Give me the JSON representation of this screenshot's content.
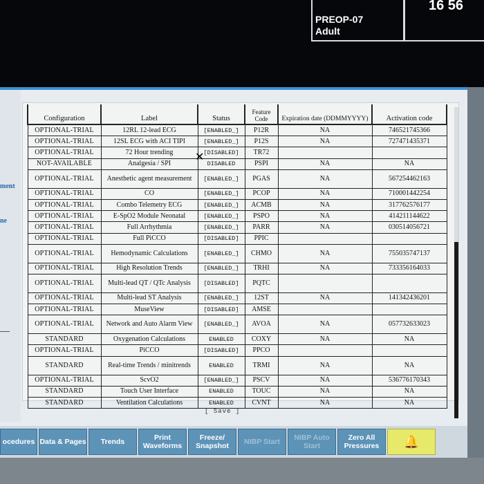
{
  "header": {
    "patient_id": "PREOP-07",
    "patient_type": "Adult",
    "time": "16 56"
  },
  "left_panel": {
    "fragment_1": "ment",
    "fragment_2": "ne"
  },
  "table": {
    "columns": {
      "configuration": "Configuration",
      "label": "Label",
      "status": "Status",
      "feature_code": "Feature Code",
      "expiration": "Expiration date (DDMMYYYY)",
      "activation": "Activation code"
    },
    "rows": [
      {
        "cfg": "OPTIONAL-TRIAL",
        "label": "12RL 12-lead ECG",
        "status": "[ENABLED_]",
        "code": "P12R",
        "exp": "NA",
        "act": "746521745366"
      },
      {
        "cfg": "OPTIONAL-TRIAL",
        "label": "12SL ECG with ACI TIPI",
        "status": "[ENABLED_]",
        "code": "P12S",
        "exp": "NA",
        "act": "727471435371"
      },
      {
        "cfg": "OPTIONAL-TRIAL",
        "label": "72 Hour trending",
        "status": "[DISABLED]",
        "code": "TR72",
        "exp": "",
        "act": ""
      },
      {
        "cfg": "NOT-AVAILABLE",
        "label": "Analgesia / SPI",
        "status": "DISABLED",
        "code": "PSPI",
        "exp": "NA",
        "act": "NA"
      },
      {
        "cfg": "OPTIONAL-TRIAL",
        "label": "Anesthetic agent measurement",
        "status": "[ENABLED_]",
        "code": "PGAS",
        "exp": "NA",
        "act": "567254462163"
      },
      {
        "cfg": "OPTIONAL-TRIAL",
        "label": "CO",
        "status": "[ENABLED_]",
        "code": "PCOP",
        "exp": "NA",
        "act": "710001442254"
      },
      {
        "cfg": "OPTIONAL-TRIAL",
        "label": "Combo Telemetry ECG",
        "status": "[ENABLED_]",
        "code": "ACMB",
        "exp": "NA",
        "act": "317762576177"
      },
      {
        "cfg": "OPTIONAL-TRIAL",
        "label": "E-SpO2 Module Neonatal",
        "status": "[ENABLED_]",
        "code": "PSPO",
        "exp": "NA",
        "act": "414211144622"
      },
      {
        "cfg": "OPTIONAL-TRIAL",
        "label": "Full Arrhythmia",
        "status": "[ENABLED_]",
        "code": "PARR",
        "exp": "NA",
        "act": "030514056721"
      },
      {
        "cfg": "OPTIONAL-TRIAL",
        "label": "Full PiCCO",
        "status": "[DISABLED]",
        "code": "PPIC",
        "exp": "",
        "act": ""
      },
      {
        "cfg": "OPTIONAL-TRIAL",
        "label": "Hemodynamic Calculations",
        "status": "[ENABLED_]",
        "code": "CHMO",
        "exp": "NA",
        "act": "755035747137"
      },
      {
        "cfg": "OPTIONAL-TRIAL",
        "label": "High Resolution Trends",
        "status": "[ENABLED_]",
        "code": "TRHI",
        "exp": "NA",
        "act": "733356164033"
      },
      {
        "cfg": "OPTIONAL-TRIAL",
        "label": "Multi-lead QT / QTc Analysis",
        "status": "[DISABLED]",
        "code": "PQTC",
        "exp": "",
        "act": ""
      },
      {
        "cfg": "OPTIONAL-TRIAL",
        "label": "Multi-lead ST Analysis",
        "status": "[ENABLED_]",
        "code": "12ST",
        "exp": "NA",
        "act": "141342436201"
      },
      {
        "cfg": "OPTIONAL-TRIAL",
        "label": "MuseView",
        "status": "[DISABLED]",
        "code": "AMSE",
        "exp": "",
        "act": ""
      },
      {
        "cfg": "OPTIONAL-TRIAL",
        "label": "Network and Auto Alarm View",
        "status": "[ENABLED_]",
        "code": "AVOA",
        "exp": "NA",
        "act": "057732633023"
      },
      {
        "cfg": "STANDARD",
        "label": "Oxygenation Calculations",
        "status": "ENABLED",
        "code": "COXY",
        "exp": "NA",
        "act": "NA"
      },
      {
        "cfg": "OPTIONAL-TRIAL",
        "label": "PiCCO",
        "status": "[DISABLED]",
        "code": "PPCO",
        "exp": "",
        "act": ""
      },
      {
        "cfg": "STANDARD",
        "label": "Real-time Trends / minitrends",
        "status": "ENABLED",
        "code": "TRMI",
        "exp": "NA",
        "act": "NA"
      },
      {
        "cfg": "OPTIONAL-TRIAL",
        "label": "ScvO2",
        "status": "[ENABLED_]",
        "code": "PSCV",
        "exp": "NA",
        "act": "536776170343"
      },
      {
        "cfg": "STANDARD",
        "label": "Touch User Interface",
        "status": "ENABLED",
        "code": "TOUC",
        "exp": "NA",
        "act": "NA"
      },
      {
        "cfg": "STANDARD",
        "label": "Ventilation Calculations",
        "status": "ENABLED",
        "code": "CVNT",
        "exp": "NA",
        "act": "NA"
      }
    ]
  },
  "save_label": "[ Save ]",
  "softkeys": [
    {
      "label": "ocedures",
      "state": "active"
    },
    {
      "label": "Data & Pages",
      "state": "active"
    },
    {
      "label": "Trends",
      "state": "active"
    },
    {
      "label": "Print Waveforms",
      "state": "active"
    },
    {
      "label": "Freeze/ Snapshot",
      "state": "active"
    },
    {
      "label": "NIBP Start",
      "state": "disabled"
    },
    {
      "label": "NIBP Auto Start",
      "state": "disabled"
    },
    {
      "label": "Zero All Pressures",
      "state": "active"
    },
    {
      "label": "🔔",
      "state": "alarm"
    }
  ],
  "colors": {
    "softkey": "#5e93b8",
    "alarm_key": "#e6e96a",
    "accent_line": "#3f8fd0"
  }
}
